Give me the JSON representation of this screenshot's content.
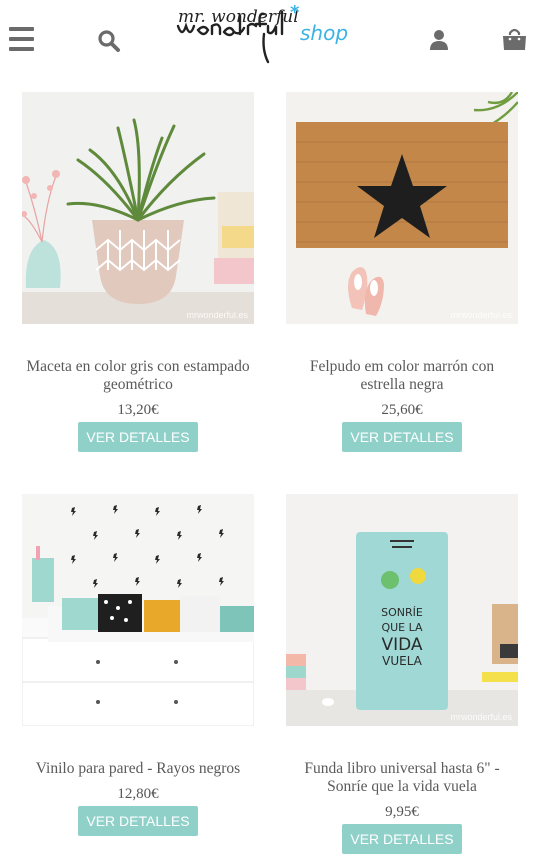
{
  "header": {
    "menu_icon": "hamburger-icon",
    "search_icon": "search-icon",
    "logo_text": "mr. wonderful",
    "logo_suffix": "shop",
    "user_icon": "user-icon",
    "cart_icon": "cart-icon"
  },
  "watermark": "mrwonderful.es",
  "products": [
    {
      "name": "Maceta en color gris con estampado geométrico",
      "price": "13,20€",
      "button": "VER DETALLES"
    },
    {
      "name": "Felpudo em color marrón con estrella negra",
      "price": "25,60€",
      "button": "VER DETALLES"
    },
    {
      "name": "Vinilo para pared - Rayos negros",
      "price": "12,80€",
      "button": "VER DETALLES"
    },
    {
      "name": "Funda libro universal hasta 6\" - Sonríe que la vida vuela",
      "price": "9,95€",
      "button": "VER DETALLES"
    }
  ],
  "colors": {
    "accent": "#8fd1c8",
    "logo_blue": "#3bb3e4",
    "icon_gray": "#6b6b6b"
  }
}
